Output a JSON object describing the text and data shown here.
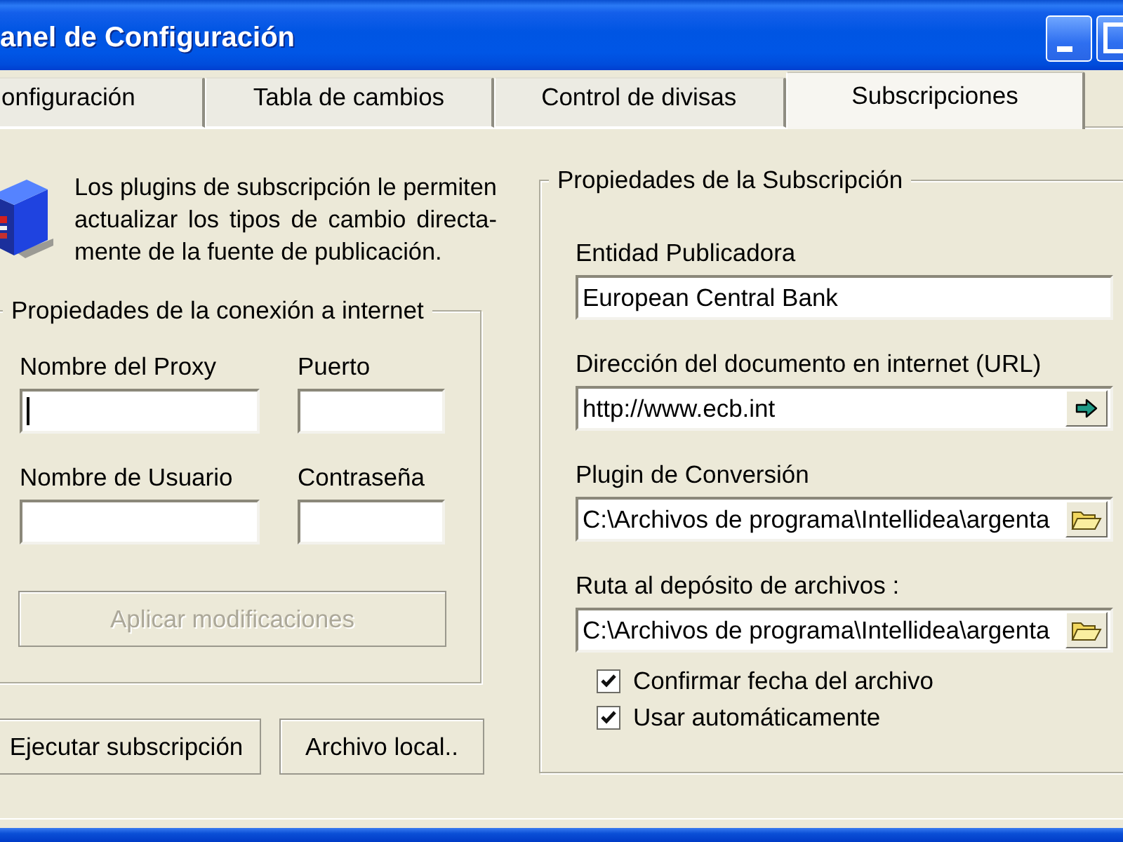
{
  "window": {
    "title": "anel de Configuración"
  },
  "tabs": [
    {
      "label": "onfiguración",
      "selected": false
    },
    {
      "label": "Tabla de cambios",
      "selected": false
    },
    {
      "label": "Control de divisas",
      "selected": false
    },
    {
      "label": "Subscripciones",
      "selected": true
    }
  ],
  "intro": {
    "lines": [
      "Los plugins de subscripción le permiten",
      "actualizar los tipos de cambio directa-",
      "mente de la fuente de publicación."
    ]
  },
  "connection_group": {
    "title": "Propiedades de la conexión a internet",
    "fields": [
      {
        "label": "Nombre del Proxy",
        "focused": true
      },
      {
        "label": "Puerto",
        "focused": false
      },
      {
        "label": "Nombre de Usuario",
        "focused": false
      },
      {
        "label": "Contraseña",
        "focused": false
      }
    ],
    "apply_button": {
      "label": "Aplicar modificaciones",
      "disabled": true
    }
  },
  "actions": [
    {
      "label": "Ejecutar subscripción"
    },
    {
      "label": "Archivo local.."
    }
  ],
  "subscription_group": {
    "title": "Propiedades de la Subscripción",
    "fields": [
      {
        "kind": "text",
        "label": "Entidad Publicadora",
        "value": "European Central Bank"
      },
      {
        "kind": "url",
        "label": "Dirección del documento en internet (URL)",
        "value": "http://www.ecb.int"
      },
      {
        "kind": "file",
        "label": "Plugin de Conversión",
        "value": "C:\\Archivos de programa\\Intellidea\\argenta"
      },
      {
        "kind": "file",
        "label": "Ruta al depósito de archivos :",
        "value": "C:\\Archivos de programa\\Intellidea\\argenta"
      }
    ],
    "options": [
      {
        "label": "Confirmar fecha del archivo",
        "checked": true
      },
      {
        "label": "Usar automáticamente",
        "checked": true
      }
    ]
  }
}
